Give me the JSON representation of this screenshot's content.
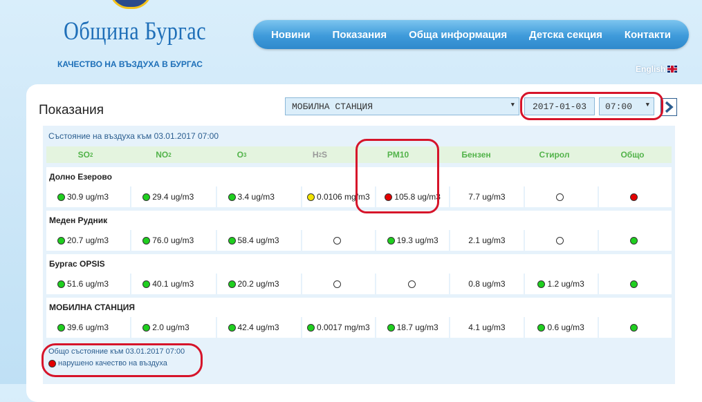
{
  "site": {
    "title": "Община Бургас",
    "subtitle": "КАЧЕСТВО НА ВЪЗДУХА В БУРГАС"
  },
  "nav": [
    "Новини",
    "Показания",
    "Обща информация",
    "Детска секция",
    "Контакти"
  ],
  "language": "English",
  "page": {
    "title": "Показания",
    "station": "МОБИЛНА СТАНЦИЯ",
    "date": "2017-01-03",
    "hour": "07:00"
  },
  "table": {
    "asof": "Състояние на въздуха към 03.01.2017 07:00",
    "headers": [
      "SO",
      "NO",
      "O",
      "H",
      "PM10",
      "Бензен",
      "Стирол",
      "Общо"
    ],
    "header_subs": [
      "2",
      "2",
      "3",
      "2",
      "",
      "",
      "",
      ""
    ],
    "header_suffix": [
      "",
      "",
      "",
      "S",
      "",
      "",
      "",
      ""
    ],
    "stations": [
      {
        "name": "Долно Езерово",
        "cells": [
          {
            "status": "green",
            "value": "30.9 ug/m3"
          },
          {
            "status": "green",
            "value": "29.4 ug/m3"
          },
          {
            "status": "green",
            "value": "3.4 ug/m3"
          },
          {
            "status": "yellow",
            "value": "0.0106 mg/m3"
          },
          {
            "status": "red",
            "value": "105.8 ug/m3"
          },
          {
            "status": "",
            "value": "7.7 ug/m3"
          },
          {
            "status": "none",
            "value": ""
          },
          {
            "status": "red",
            "value": ""
          }
        ]
      },
      {
        "name": "Меден Рудник",
        "cells": [
          {
            "status": "green",
            "value": "20.7 ug/m3"
          },
          {
            "status": "green",
            "value": "76.0 ug/m3"
          },
          {
            "status": "green",
            "value": "58.4 ug/m3"
          },
          {
            "status": "none",
            "value": ""
          },
          {
            "status": "green",
            "value": "19.3 ug/m3"
          },
          {
            "status": "",
            "value": "2.1 ug/m3"
          },
          {
            "status": "none",
            "value": ""
          },
          {
            "status": "green",
            "value": ""
          }
        ]
      },
      {
        "name": "Бургас OPSIS",
        "cells": [
          {
            "status": "green",
            "value": "51.6 ug/m3"
          },
          {
            "status": "green",
            "value": "40.1 ug/m3"
          },
          {
            "status": "green",
            "value": "20.2 ug/m3"
          },
          {
            "status": "none",
            "value": ""
          },
          {
            "status": "none",
            "value": ""
          },
          {
            "status": "",
            "value": "0.8 ug/m3"
          },
          {
            "status": "green",
            "value": "1.2 ug/m3"
          },
          {
            "status": "green",
            "value": ""
          }
        ]
      },
      {
        "name": "МОБИЛНА СТАНЦИЯ",
        "cells": [
          {
            "status": "green",
            "value": "39.6 ug/m3"
          },
          {
            "status": "green",
            "value": "2.0 ug/m3"
          },
          {
            "status": "green",
            "value": "42.4 ug/m3"
          },
          {
            "status": "green",
            "value": "0.0017 mg/m3"
          },
          {
            "status": "green",
            "value": "18.7 ug/m3"
          },
          {
            "status": "",
            "value": "4.1 ug/m3"
          },
          {
            "status": "green",
            "value": "0.6 ug/m3"
          },
          {
            "status": "green",
            "value": ""
          }
        ]
      }
    ]
  },
  "overall": {
    "label": "Общо състояние към 03.01.2017 07:00",
    "legend_status": "red",
    "legend_text": "нарушено качество на въздуха"
  },
  "colors": {
    "good": "#1fcf1f",
    "moderate": "#f2e400",
    "bad": "#e30000",
    "nav": "#3e9ada",
    "annotation": "#d6142a"
  },
  "icons": {
    "next": "chevron-right-icon",
    "dropdown": "caret-down-icon",
    "flag": "uk-flag-icon"
  }
}
